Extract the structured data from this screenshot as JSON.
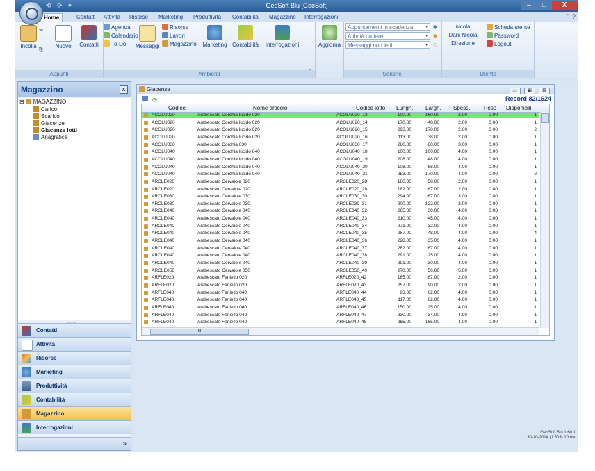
{
  "window": {
    "title": "GeoSoft Blu [GeoSoft]",
    "quick_access": "⟲ ⟳ ▾",
    "min": "–",
    "max": "□",
    "close": "X"
  },
  "tabs": [
    "Home",
    "Contatti",
    "Attività",
    "Risorse",
    "Marketing",
    "Produttività",
    "Contabilità",
    "Magazzino",
    "Interrogazioni"
  ],
  "tab_icons": "⌃ ?",
  "ribbon": {
    "appunti": {
      "label": "Appunti",
      "incolla": "Incolla",
      "nuovo": "Nuovo",
      "contatti": "Contatti"
    },
    "ambienti": {
      "label": "Ambienti",
      "agenda": "Agenda",
      "calendario": "Calendario",
      "todo": "To-Do",
      "messaggi": "Messaggi",
      "risorse": "Risorse",
      "lavori": "Lavori",
      "magazzino": "Magazzino",
      "marketing": "Marketing",
      "contabilita": "Contabilità",
      "interrogazioni": "Interrogazioni"
    },
    "aggiorna": "Aggiorna",
    "sentinel": {
      "label": "Sentinel",
      "items": [
        "Appuntamenti in scadenza",
        "Attività da fare",
        "Messaggi non letti"
      ]
    },
    "utente": {
      "label": "Utente",
      "user": "nicola",
      "full_name": "Dani Nicola",
      "department": "Direzione",
      "scheda": "Scheda utente",
      "password": "Password",
      "logout": "Logout"
    }
  },
  "nav": {
    "title": "Magazzino",
    "close": "x",
    "tree_root": "MAGAZZINO",
    "tree_items": [
      "Carico",
      "Scarico",
      "Giacenze",
      "Giacenze lotti",
      "Anagrafica"
    ],
    "buttons": [
      "Contatti",
      "Attività",
      "Risorse",
      "Marketing",
      "Produttività",
      "Contabilità",
      "Magazzino",
      "Interrogazioni"
    ],
    "chevron": "»"
  },
  "child": {
    "title": "Giacenze",
    "buttons": [
      "▭",
      "▣",
      "⊠"
    ],
    "refresh": "⟳",
    "record": "Record 82/1624"
  },
  "grid": {
    "columns": [
      "Codice",
      "Nome articolo",
      "Codice lotto",
      "Lungh.",
      "Largh.",
      "Spess.",
      "Peso",
      "Disponibili"
    ],
    "rows": [
      [
        "ACOLU020",
        "Arabescato Corchia lucido 020",
        "ACOLU020_13",
        "100.00",
        "160.00",
        "2.00",
        "0.00",
        "1"
      ],
      [
        "ACOLU020",
        "Arabescato Corchia lucido 020",
        "ACOLU020_14",
        "170.00",
        "48.00",
        "2.00",
        "0.00",
        "1"
      ],
      [
        "ACOLU020",
        "Arabescato Corchia lucido 020",
        "ACOLU020_15",
        "293.00",
        "170.00",
        "2.00",
        "0.00",
        "2"
      ],
      [
        "ACOLU020",
        "Arabescato Corchia lucido 020",
        "ACOLU020_16",
        "113.00",
        "38.00",
        "2.00",
        "0.00",
        "1"
      ],
      [
        "ACOLU030",
        "Arabescato Corchia 030",
        "ACOLU030_17",
        "280.00",
        "80.00",
        "3.00",
        "0.00",
        "1"
      ],
      [
        "ACOLU040",
        "Arabescato Corchia lucido 040",
        "ACOLU040_18",
        "100.00",
        "100.00",
        "4.00",
        "0.00",
        "1"
      ],
      [
        "ACOLU040",
        "Arabescato Corchia lucido 040",
        "ACOLU040_19",
        "208.00",
        "48.00",
        "4.00",
        "0.00",
        "1"
      ],
      [
        "ACOLU040",
        "Arabescato Corchia lucido 040",
        "ACOLU040_20",
        "108.00",
        "68.00",
        "4.00",
        "0.00",
        "1"
      ],
      [
        "ACOLU040",
        "Arabescato Corchia lucido 040",
        "ACOLU040_21",
        "283.00",
        "170.00",
        "4.00",
        "0.00",
        "2"
      ],
      [
        "ARCLE020",
        "Arabescato Cervaiole 020",
        "ARCLE020_28",
        "180.00",
        "58.00",
        "2.00",
        "0.00",
        "1"
      ],
      [
        "ARCLE020",
        "Arabescato Cervaiole 020",
        "ARCLE020_29",
        "182.00",
        "87.00",
        "2.00",
        "0.00",
        "1"
      ],
      [
        "ARCLE030",
        "Arabescato Cervaiole 030",
        "ARCLE030_30",
        "294.00",
        "67.00",
        "3.00",
        "0.00",
        "1"
      ],
      [
        "ARCLE030",
        "Arabescato Cervaiole 030",
        "ARCLE030_31",
        "200.00",
        "122.00",
        "3.00",
        "0.00",
        "1"
      ],
      [
        "ARCLE040",
        "Arabescato Cervaiole 040",
        "ARCLE040_32",
        "265.00",
        "30.00",
        "4.00",
        "0.00",
        "1"
      ],
      [
        "ARCLE040",
        "Arabescato Cervaiole 040",
        "ARCLE040_33",
        "210.00",
        "45.00",
        "4.00",
        "0.00",
        "1"
      ],
      [
        "ARCLE040",
        "Arabescato Cervaiole 040",
        "ARCLE040_34",
        "271.00",
        "32.00",
        "4.00",
        "0.00",
        "1"
      ],
      [
        "ARCLE040",
        "Arabescato Cervaiole 040",
        "ARCLE040_35",
        "287.00",
        "48.00",
        "4.00",
        "0.00",
        "4"
      ],
      [
        "ARCLE040",
        "Arabescato Cervaiole 040",
        "ARCLE040_36",
        "228.00",
        "35.00",
        "4.00",
        "0.00",
        "1"
      ],
      [
        "ARCLE040",
        "Arabescato Cervaiole 040",
        "ARCLE040_37",
        "262.00",
        "67.00",
        "4.00",
        "0.00",
        "1"
      ],
      [
        "ARCLE040",
        "Arabescato Cervaiole 040",
        "ARCLE040_38",
        "291.00",
        "25.00",
        "4.00",
        "0.00",
        "1"
      ],
      [
        "ARCLE040",
        "Arabescato Cervaiole 040",
        "ARCLE040_39",
        "291.00",
        "30.00",
        "4.00",
        "0.00",
        "1"
      ],
      [
        "ARCLE050",
        "Arabescato Cervaiole 050",
        "ARCLE050_40",
        "270.00",
        "56.00",
        "5.00",
        "0.00",
        "1"
      ],
      [
        "ARFLE020",
        "Arabescato Faniello 020",
        "ARFLE020_42",
        "165.00",
        "87.00",
        "2.00",
        "0.00",
        "1"
      ],
      [
        "ARFLE020",
        "Arabescato Faniello 020",
        "ARFLE020_43",
        "257.00",
        "90.00",
        "2.00",
        "0.00",
        "1"
      ],
      [
        "ARFLE040",
        "Arabescato Faniello 040",
        "ARFLE040_44",
        "93.00",
        "62.00",
        "4.00",
        "0.00",
        "1"
      ],
      [
        "ARFLE040",
        "Arabescato Faniello 040",
        "ARFLE040_45",
        "117.00",
        "62.00",
        "4.00",
        "0.00",
        "1"
      ],
      [
        "ARFLE040",
        "Arabescato Faniello 040",
        "ARFLE040_46",
        "150.00",
        "25.00",
        "4.00",
        "0.00",
        "1"
      ],
      [
        "ARFLE040",
        "Arabescato Faniello 040",
        "ARFLE040_47",
        "230.00",
        "34.00",
        "4.00",
        "0.00",
        "1"
      ],
      [
        "ARFLE040",
        "Arabescato Faniello 040",
        "ARFLE040_48",
        "255.00",
        "165.00",
        "4.00",
        "0.00",
        "1"
      ]
    ],
    "hscroll_thumb": "III"
  },
  "status": {
    "line1": "GeoSoft Blu 1.60.1",
    "line2": "30-10-2014 (1.603) 10 usr"
  },
  "colors": {
    "accent": "#15428b",
    "selected_row": "#7be27b",
    "active_nav": "#f5c04a"
  }
}
